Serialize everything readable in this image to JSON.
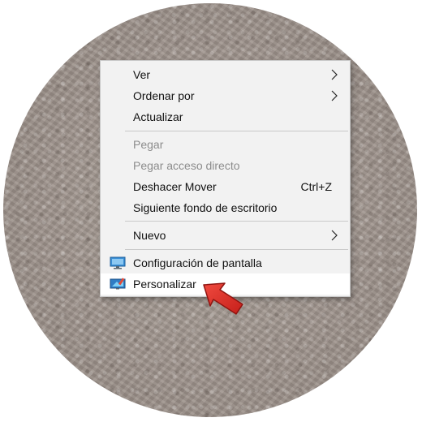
{
  "menu": {
    "items": [
      {
        "label": "Ver",
        "has_submenu": true,
        "enabled": true
      },
      {
        "label": "Ordenar por",
        "has_submenu": true,
        "enabled": true
      },
      {
        "label": "Actualizar",
        "enabled": true
      },
      {
        "label": "Pegar",
        "enabled": false
      },
      {
        "label": "Pegar acceso directo",
        "enabled": false
      },
      {
        "label": "Deshacer Mover",
        "shortcut": "Ctrl+Z",
        "enabled": true
      },
      {
        "label": "Siguiente fondo de escritorio",
        "enabled": true
      },
      {
        "label": "Nuevo",
        "has_submenu": true,
        "enabled": true
      },
      {
        "label": "Configuración de pantalla",
        "icon": "display-settings-icon",
        "enabled": true
      },
      {
        "label": "Personalizar",
        "icon": "personalize-icon",
        "enabled": true,
        "hovered": true
      }
    ]
  },
  "colors": {
    "menu_background": "#f2f2f2",
    "hover_background": "#ffffff",
    "disabled_text": "#8c8c8c",
    "pointer_arrow": "#e8322d"
  },
  "pointer": {
    "icon": "red-pointer-arrow-icon"
  }
}
